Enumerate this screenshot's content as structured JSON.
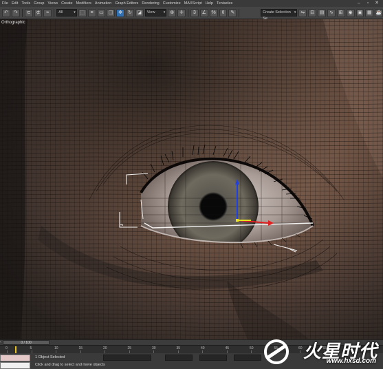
{
  "menu": [
    "File",
    "Edit",
    "Tools",
    "Group",
    "Views",
    "Create",
    "Modifiers",
    "Animation",
    "Graph Editors",
    "Rendering",
    "Customize",
    "MAXScript",
    "Help",
    "Tentacles"
  ],
  "toolbar": {
    "selection_filter": "All",
    "ref_coord": "View",
    "named_selection": "Create Selection Se"
  },
  "viewport": {
    "label": "Orthographic"
  },
  "timeline": {
    "frame_counter": "0 / 100",
    "ticks": [
      "0",
      "5",
      "10",
      "15",
      "20",
      "25",
      "30",
      "35",
      "40",
      "45",
      "50",
      "55",
      "60",
      "65"
    ]
  },
  "status": {
    "selection": "1 Object Selected",
    "prompt": "Click and drag to select and move objects"
  },
  "watermark": {
    "brand": "火星时代",
    "url": "www.hxsd.com"
  },
  "colors": {
    "skin": "#7a5a4c",
    "wire": "#151010",
    "accent": "#2f6fb3",
    "gizmo_x": "#e02020",
    "gizmo_y": "#e8e020",
    "gizmo_z": "#2040e0"
  }
}
